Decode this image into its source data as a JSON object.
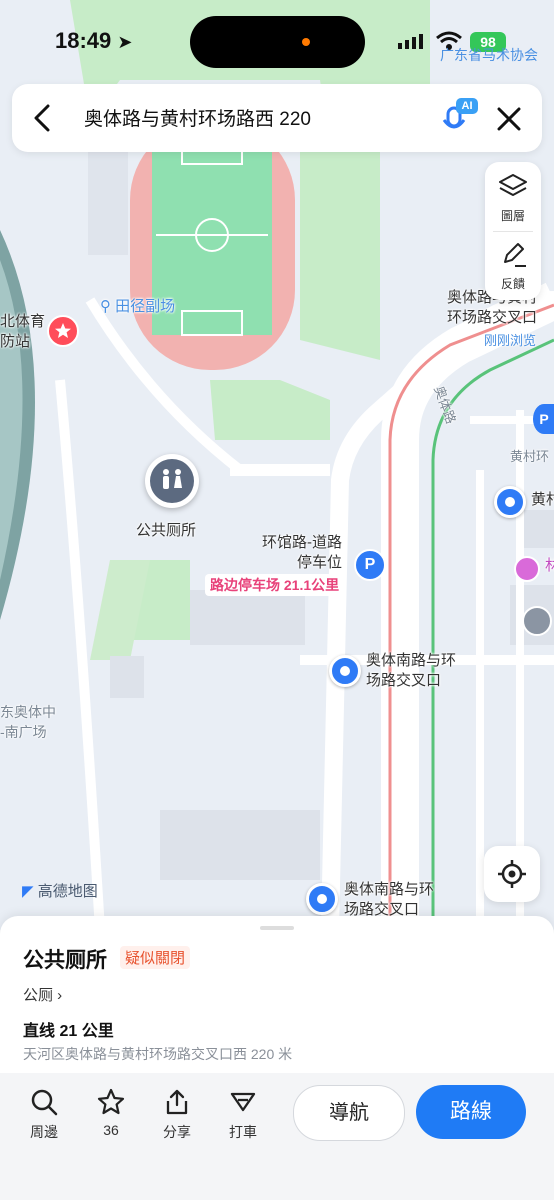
{
  "status_bar": {
    "time": "18:49",
    "battery": "98",
    "overlay_text": "广东省马术协会"
  },
  "search": {
    "title": "奥体路与黄村环场路西 220",
    "ai_badge": "AI"
  },
  "tools": {
    "layers_label": "圖層",
    "feedback_label": "反饋"
  },
  "map": {
    "labels": {
      "track_field": "田径副场",
      "left_poi_line1": "北体育",
      "left_poi_line2": "防站",
      "junction_top_line1": "奥体路与黄村",
      "junction_top_line2": "环场路交叉口",
      "recent_view": "刚刚浏览",
      "road_vertical": "奥体路",
      "right_road": "黄村环",
      "right_poi": "黄村",
      "right_poi2": "林",
      "toilet": "公共厕所",
      "parking_line1": "环馆路-道路",
      "parking_line2": "停车位",
      "parking_tag": "路边停车场 21.1公里",
      "junction_mid_line1": "奥体南路与环",
      "junction_mid_line2": "场路交叉口",
      "left_area_line1": "东奥体中",
      "left_area_line2": "-南广场",
      "junction_bottom_line1": "奥体南路与环",
      "junction_bottom_line2": "场路交叉口",
      "logo": "高德地图"
    }
  },
  "place": {
    "name": "公共厕所",
    "badge": "疑似關閉",
    "category": "公厕",
    "distance": "直线 21 公里",
    "address": "天河区奥体路与黄村环场路交叉口西 220 米"
  },
  "actions": {
    "nearby": "周邊",
    "favorite_count": "36",
    "share": "分享",
    "taxi": "打車",
    "navigate": "導航",
    "route": "路線"
  },
  "colors": {
    "accent": "#1f7bf5",
    "badge": "#e8532f",
    "field": "#8fe0b0",
    "track": "#f2b2b0"
  }
}
